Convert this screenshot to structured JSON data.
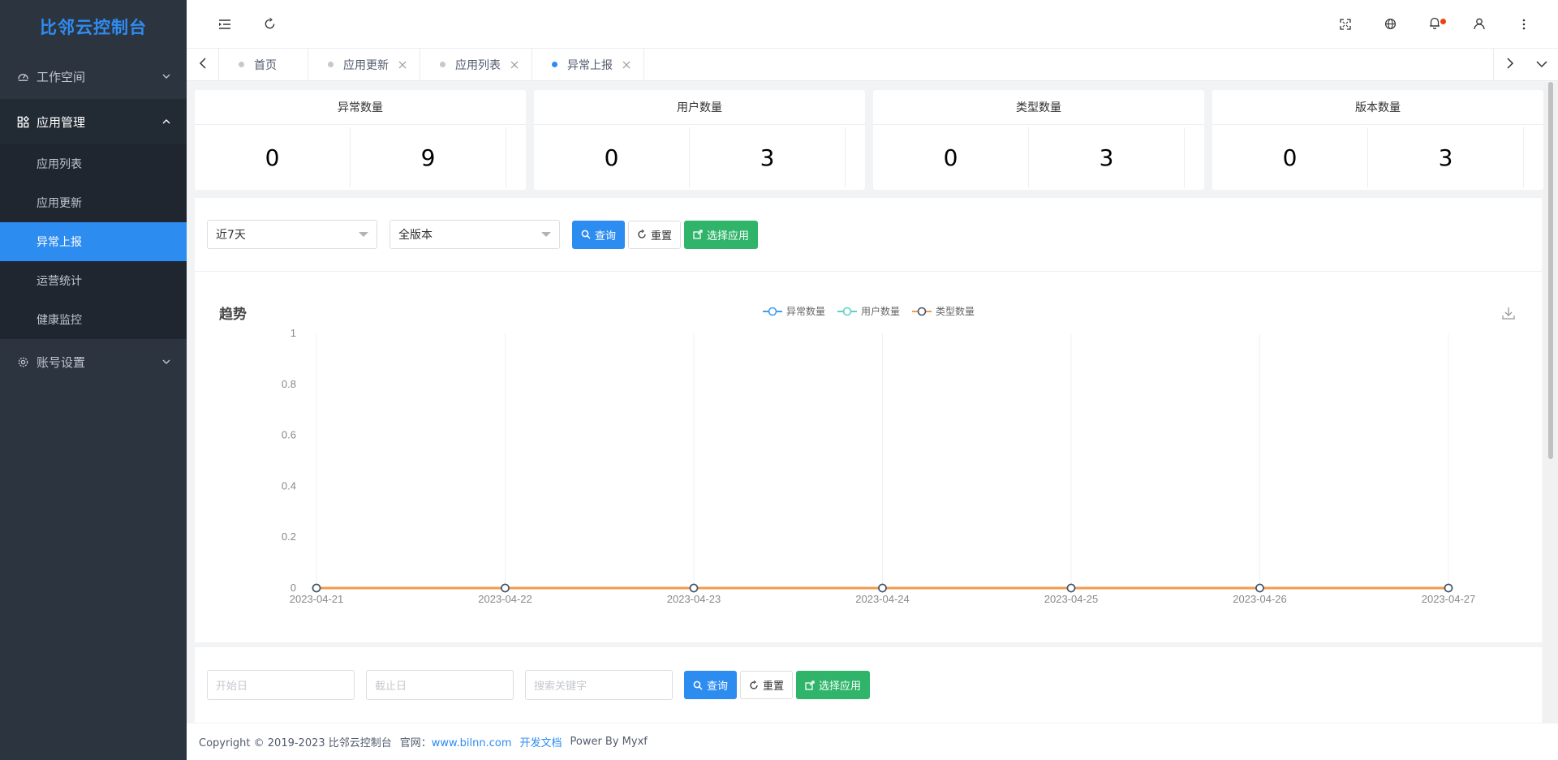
{
  "app": {
    "logo_text": "比邻云控制台"
  },
  "sidebar": {
    "groups": [
      {
        "label": "工作空间",
        "icon": "dashboard-icon",
        "open": false
      },
      {
        "label": "应用管理",
        "icon": "apps-icon",
        "open": true,
        "items": [
          "应用列表",
          "应用更新",
          "异常上报",
          "运营统计",
          "健康监控"
        ],
        "active": "异常上报"
      },
      {
        "label": "账号设置",
        "icon": "gear-icon",
        "open": false
      }
    ]
  },
  "header": {
    "left_icons": [
      "menu-collapse-icon",
      "refresh-icon"
    ],
    "right_icons": [
      "fullscreen-icon",
      "globe-icon",
      "bell-icon",
      "user-icon",
      "more-icon"
    ]
  },
  "tabs": {
    "items": [
      {
        "label": "首页",
        "closable": false
      },
      {
        "label": "应用更新",
        "closable": true
      },
      {
        "label": "应用列表",
        "closable": true
      },
      {
        "label": "异常上报",
        "closable": true,
        "active": true
      }
    ]
  },
  "stats": [
    {
      "title": "异常数量",
      "today": "0",
      "total": "9"
    },
    {
      "title": "用户数量",
      "today": "0",
      "total": "3"
    },
    {
      "title": "类型数量",
      "today": "0",
      "total": "3"
    },
    {
      "title": "版本数量",
      "today": "0",
      "total": "3"
    }
  ],
  "filter1": {
    "range_value": "近7天",
    "version_value": "全版本",
    "query_label": "查询",
    "reset_label": "重置",
    "select_app_label": "选择应用"
  },
  "chart_data": {
    "type": "line",
    "title": "趋势",
    "x": [
      "2023-04-21",
      "2023-04-22",
      "2023-04-23",
      "2023-04-24",
      "2023-04-25",
      "2023-04-26",
      "2023-04-27"
    ],
    "series": [
      {
        "name": "异常数量",
        "color": "#3b9ff2",
        "values": [
          0,
          0,
          0,
          0,
          0,
          0,
          0
        ]
      },
      {
        "name": "用户数量",
        "color": "#5ed3c4",
        "values": [
          0,
          0,
          0,
          0,
          0,
          0,
          0
        ]
      },
      {
        "name": "类型数量",
        "color": "#f39a4e",
        "values": [
          0,
          0,
          0,
          0,
          0,
          0,
          0
        ]
      }
    ],
    "ylim": [
      0,
      1
    ],
    "yticks": [
      "0",
      "0.2",
      "0.4",
      "0.6",
      "0.8",
      "1"
    ],
    "grid": "vertical",
    "legend": "top-center"
  },
  "filter2": {
    "start_placeholder": "开始日",
    "end_placeholder": "截止日",
    "keyword_placeholder": "搜索关键字",
    "query_label": "查询",
    "reset_label": "重置",
    "select_app_label": "选择应用"
  },
  "footer": {
    "copyright": "Copyright © 2019-2023 比邻云控制台",
    "site_label": "官网：",
    "site_link": "www.bilnn.com",
    "docs_link": "开发文档",
    "powered": "Power By Myxf"
  }
}
